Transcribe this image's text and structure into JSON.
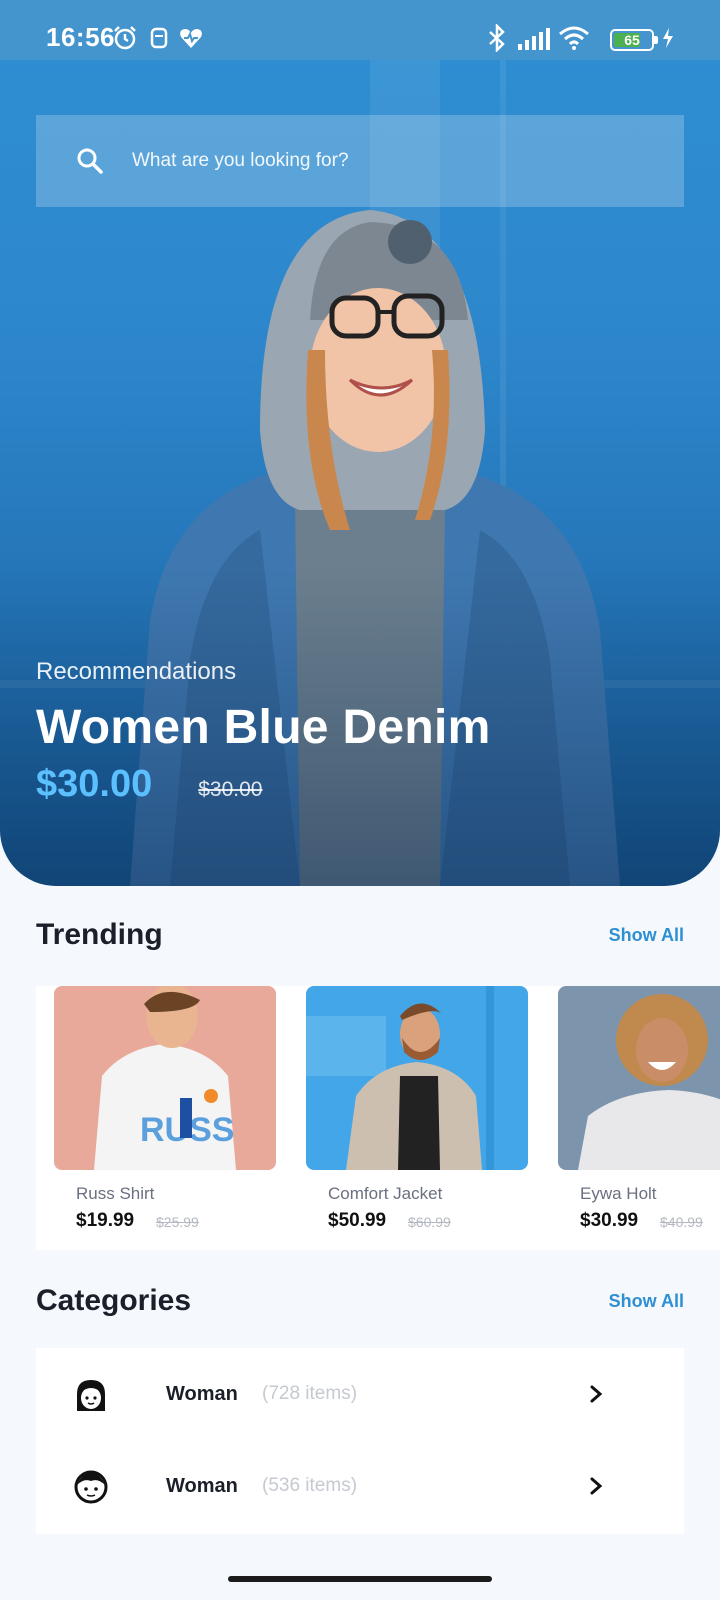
{
  "status_bar": {
    "time": "16:56",
    "battery": "65",
    "icons": [
      "alarm-icon",
      "notification-icon",
      "health-icon",
      "bluetooth-icon",
      "signal-icon",
      "wifi-icon",
      "battery-icon",
      "charging-icon"
    ]
  },
  "search": {
    "placeholder": "What are you looking for?"
  },
  "hero": {
    "label": "Recommendations",
    "title": "Women Blue Denim",
    "price": "$30.00",
    "old_price": "$30.00"
  },
  "trending": {
    "title": "Trending",
    "show_all": "Show All",
    "items": [
      {
        "name": "Russ Shirt",
        "price": "$19.99",
        "old_price": "$25.99",
        "shirt_print": "RUSS"
      },
      {
        "name": "Comfort Jacket",
        "price": "$50.99",
        "old_price": "$60.99"
      },
      {
        "name": "Eywa Holt",
        "price": "$30.99",
        "old_price": "$40.99"
      }
    ]
  },
  "categories": {
    "title": "Categories",
    "show_all": "Show All",
    "items": [
      {
        "name": "Woman",
        "count": "(728 items)",
        "icon": "woman-face-icon"
      },
      {
        "name": "Woman",
        "count": "(536 items)",
        "icon": "man-face-icon"
      }
    ]
  },
  "colors": {
    "accent": "#2f8fd3",
    "hero_price": "#5cc0ff",
    "background": "#f5f8fc"
  }
}
